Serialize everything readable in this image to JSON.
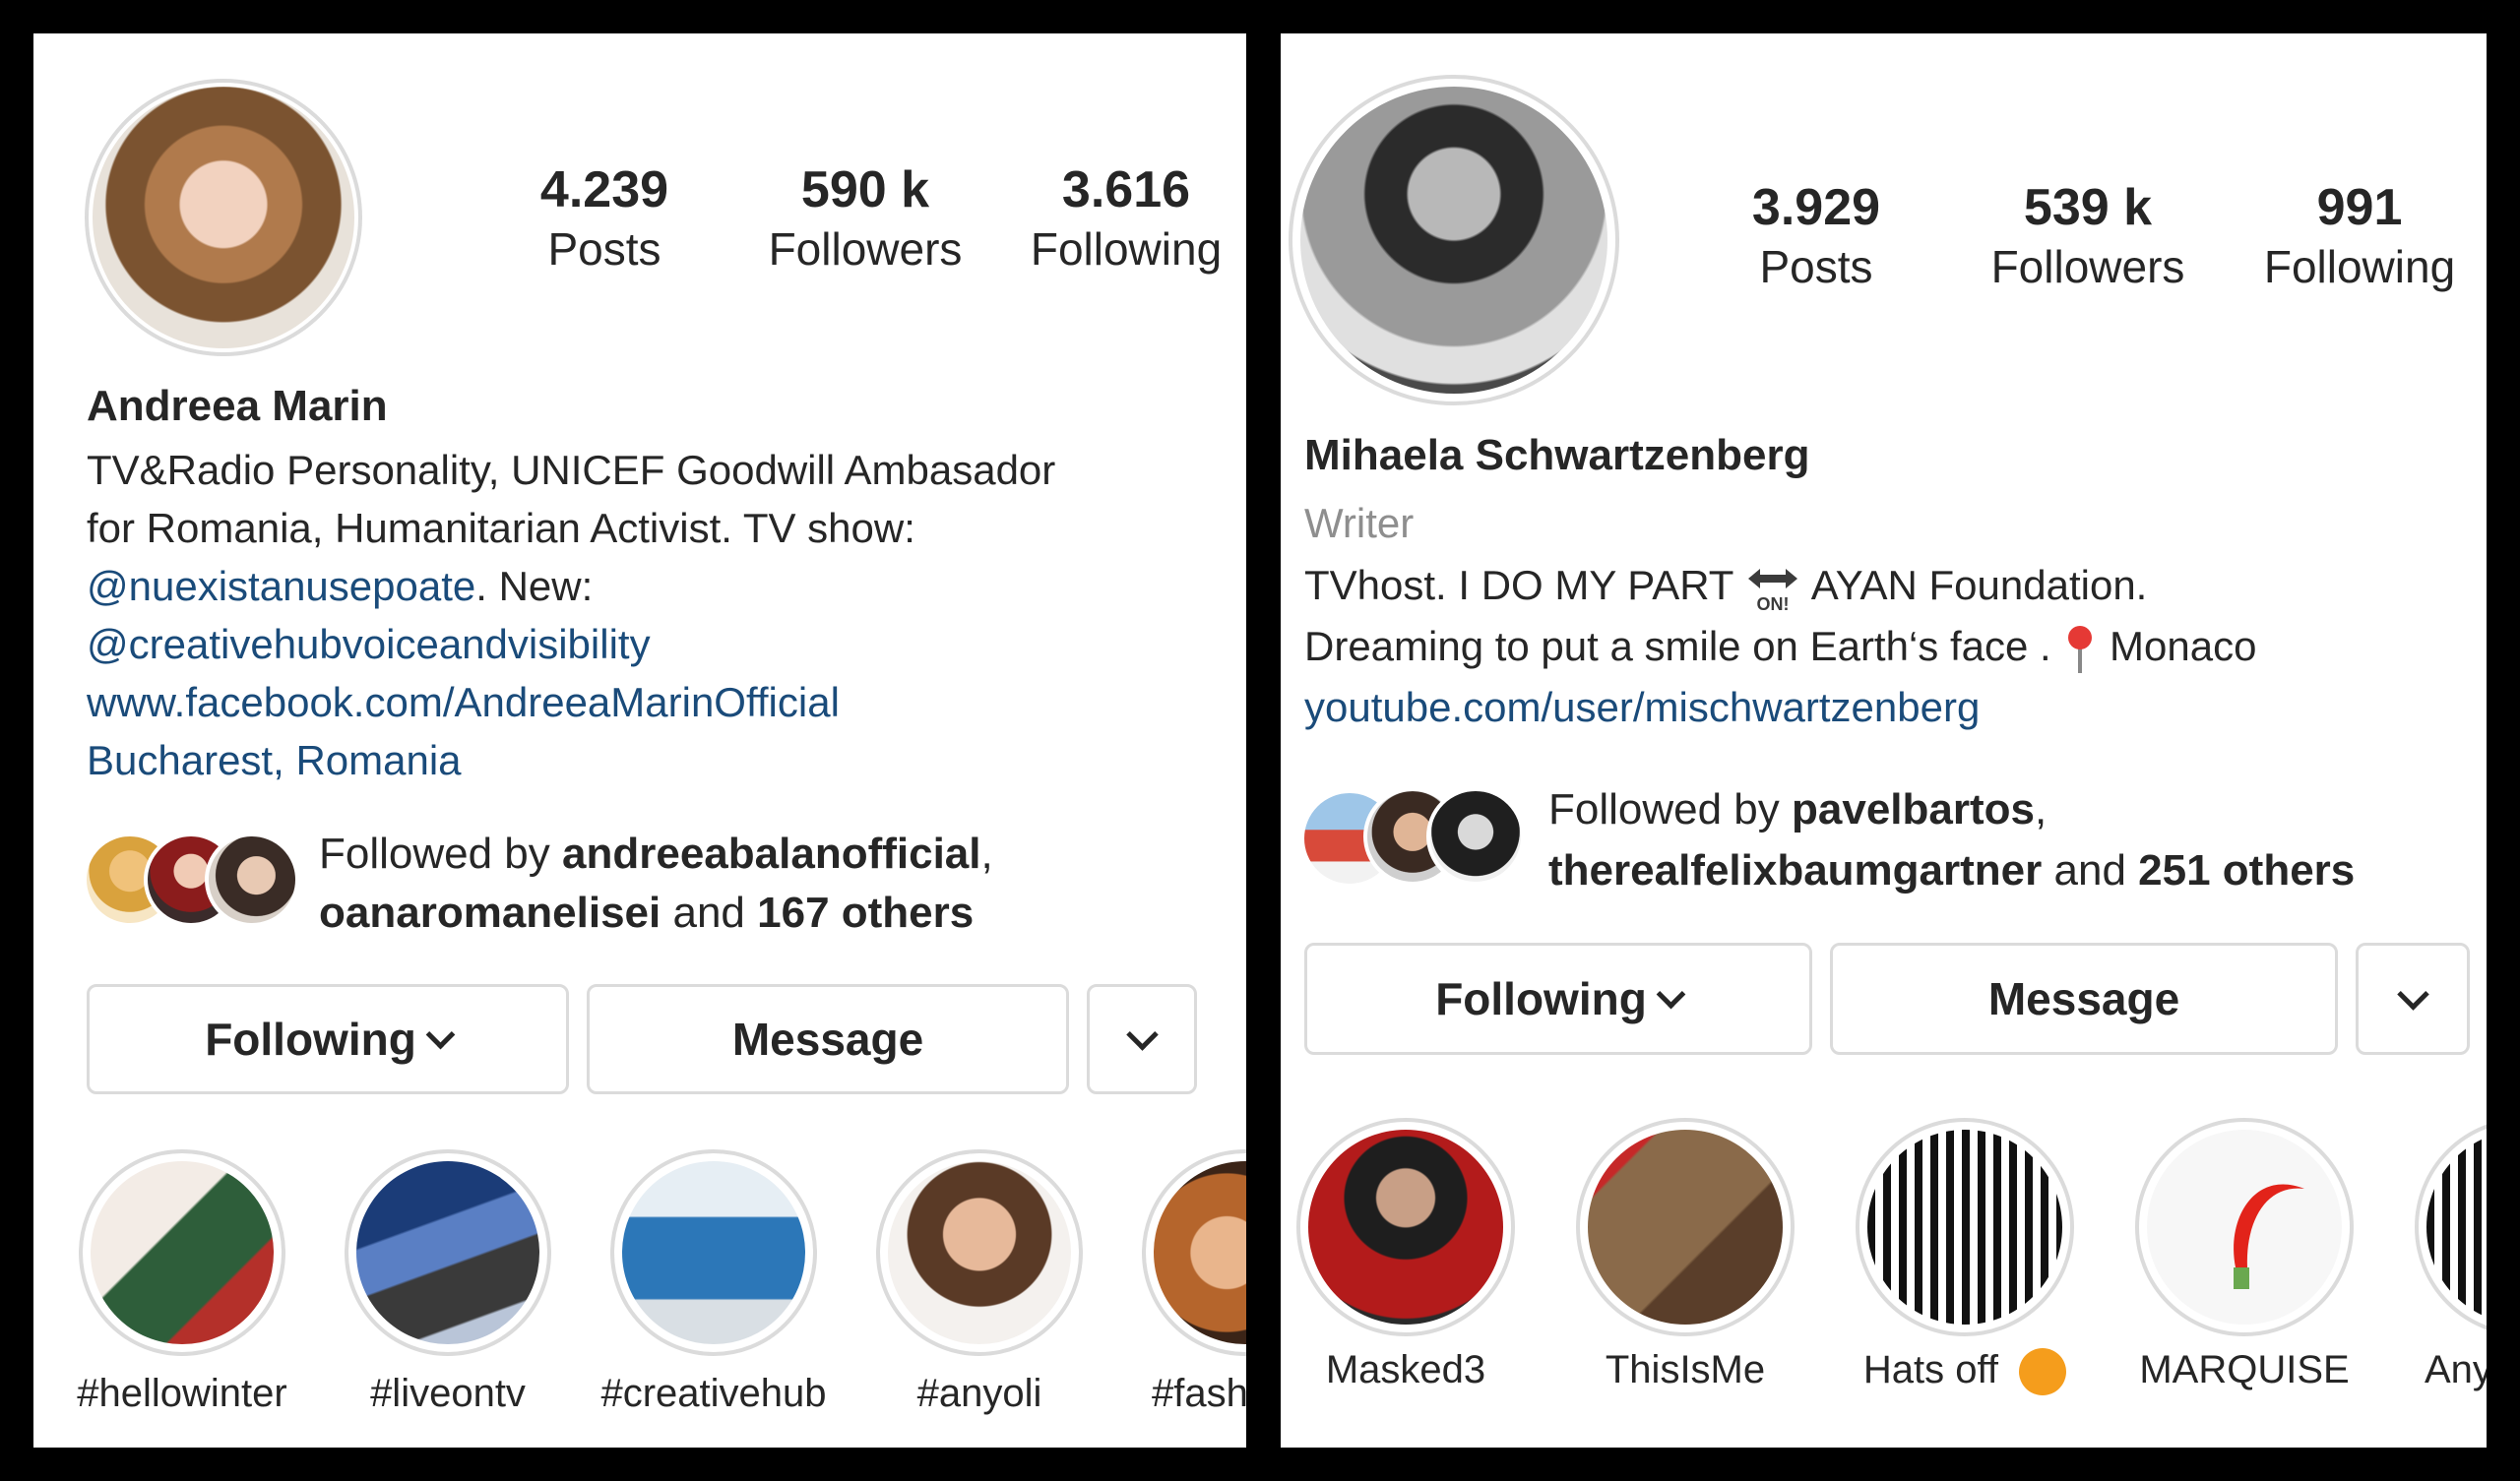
{
  "left": {
    "stats": [
      {
        "value": "4.239",
        "label": "Posts"
      },
      {
        "value": "590 k",
        "label": "Followers"
      },
      {
        "value": "3.616",
        "label": "Following"
      }
    ],
    "name": "Andreea Marin",
    "bio_line1": "TV&Radio Personality, UNICEF Goodwill Ambasador",
    "bio_line2": "for Romania, Humanitarian Activist. TV show:",
    "bio_mention1": "@nuexistanusepoate",
    "bio_after_mention1": ". New:",
    "bio_mention2": "@creativehubvoiceandvisibility",
    "bio_link": "www.facebook.com/AndreeaMarinOfficial",
    "location": "Bucharest, Romania",
    "followed_by_prefix": "Followed by ",
    "followed_by_user1": "andreeabalanofficial",
    "followed_by_comma": ",",
    "followed_by_user2": "oanaromanelisei",
    "followed_by_and": " and ",
    "followed_by_others": "167 others",
    "buttons": {
      "following": "Following",
      "message": "Message"
    },
    "highlights": [
      "#hellowinter",
      "#liveontv",
      "#creativehub",
      "#anyoli",
      "#fash"
    ]
  },
  "right": {
    "stats": [
      {
        "value": "3.929",
        "label": "Posts"
      },
      {
        "value": "539 k",
        "label": "Followers"
      },
      {
        "value": "991",
        "label": "Following"
      }
    ],
    "name": "Mihaela Schwartzenberg",
    "category": "Writer",
    "bio_line1_a": "TVhost. I DO MY PART ",
    "bio_line1_b": " AYAN Foundation.",
    "bio_line2": "Dreaming to put a smile on Earth‘s face . ",
    "bio_line2_b": " Monaco",
    "bio_link": "youtube.com/user/mischwartzenberg",
    "followed_by_prefix": "Followed by ",
    "followed_by_user1": "pavelbartos",
    "followed_by_comma": ",",
    "followed_by_user2": "therealfelixbaumgartner",
    "followed_by_and": " and ",
    "followed_by_others": "251 others",
    "buttons": {
      "following": "Following",
      "message": "Message"
    },
    "highlights": [
      "Masked3",
      "ThisIsMe",
      "Hats off",
      "MARQUISE",
      "Any"
    ]
  }
}
